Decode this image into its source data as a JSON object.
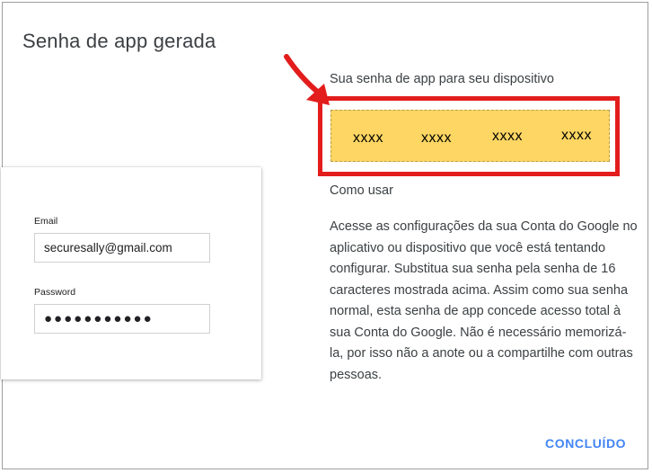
{
  "dialog": {
    "title": "Senha de app gerada",
    "password_heading": "Sua senha de app para seu dispositivo",
    "password_groups": [
      "xxxx",
      "xxxx",
      "xxxx",
      "xxxx"
    ],
    "how_to_heading": "Como usar",
    "instructions": "Acesse as configurações da sua Conta do Google no aplicativo ou dispositivo que você está tentando configurar. Substitua sua senha pela senha de 16 caracteres mostrada acima. Assim como sua senha normal, esta senha de app concede acesso total à sua Conta do Google. Não é necessário memorizá-la, por isso não a anote ou a compartilhe com outras pessoas.",
    "done_label": "CONCLUÍDO"
  },
  "preview": {
    "email_label": "Email",
    "email_value": "securesally@gmail.com",
    "password_label": "Password",
    "password_value": "●●●●●●●●●●●"
  },
  "colors": {
    "highlight": "#e31c1c",
    "password_bg": "#fdd663",
    "accent": "#4285f4"
  },
  "icons": [
    "red-arrow-icon"
  ]
}
